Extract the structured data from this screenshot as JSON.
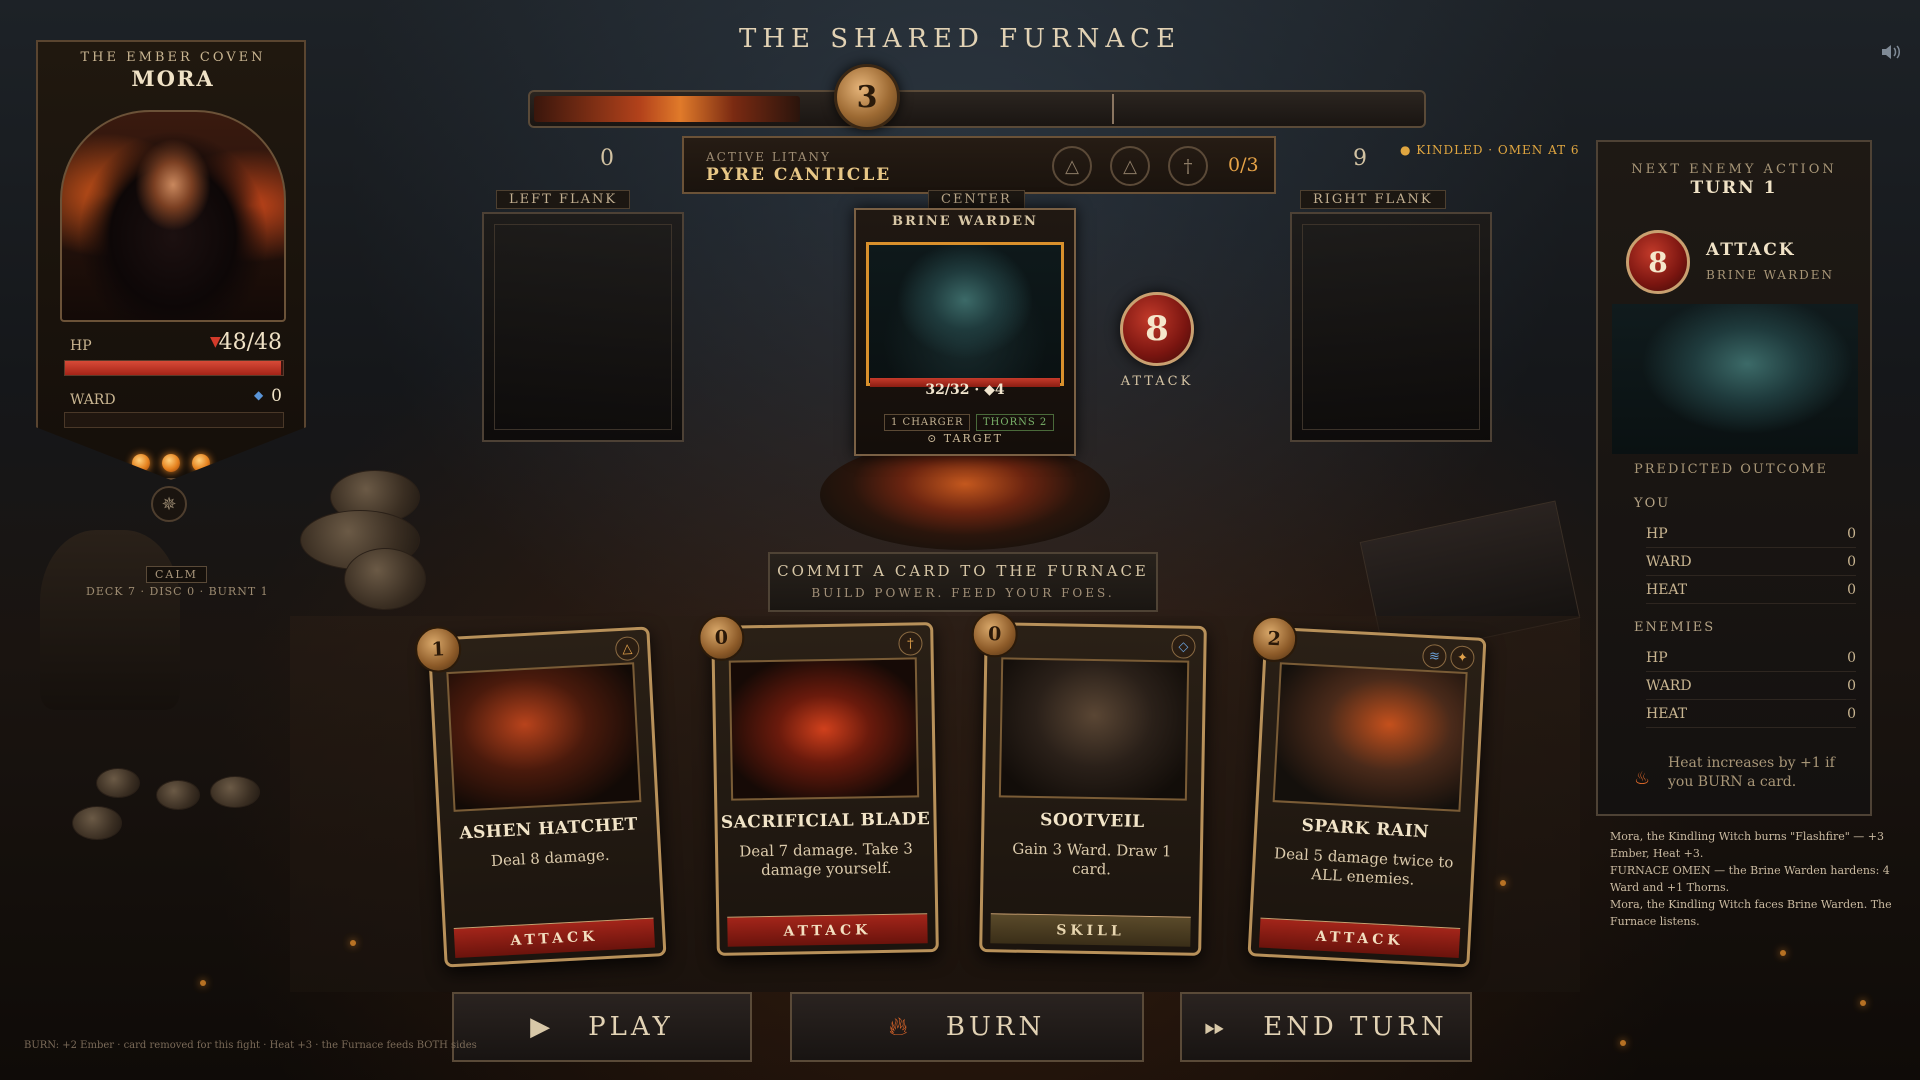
{
  "title": "THE SHARED FURNACE",
  "power": {
    "value": "3",
    "min_label": "0",
    "max_label": "9",
    "fill_fraction": 0.3
  },
  "omen_note": "● KINDLED · OMEN AT 6",
  "litany": {
    "label": "ACTIVE LITANY",
    "name": "PYRE CANTICLE",
    "glyphs": [
      "△",
      "△",
      "†"
    ],
    "progress": "0/3"
  },
  "player": {
    "coven": "THE EMBER COVEN",
    "name": "MORA",
    "hp_label": "HP",
    "hp_value": "48/48",
    "hp_fraction": 1.0,
    "ward_label": "WARD",
    "ward_value": "0",
    "ember_count": 3,
    "status": "CALM",
    "piles": "DECK 7 · DISC 0 · BURNT 1"
  },
  "flanks": {
    "left": "LEFT FLANK",
    "center": "CENTER",
    "right": "RIGHT FLANK"
  },
  "enemy": {
    "name": "BRINE WARDEN",
    "stats": "32/32 · ◆4",
    "hp_fraction": 1.0,
    "tags": [
      "1 CHARGER",
      "THORNS 2"
    ],
    "target_label": "⊙ TARGET",
    "intent_value": "8",
    "intent_label": "ATTACK"
  },
  "furnace_prompt": {
    "title": "COMMIT A CARD TO THE FURNACE",
    "subtitle": "BUILD POWER. FEED YOUR FOES."
  },
  "hand": [
    {
      "cost": "1",
      "name": "ASHEN HATCHET",
      "desc": "Deal 8 damage.",
      "type": "ATTACK",
      "elements": [
        "△"
      ]
    },
    {
      "cost": "0",
      "name": "SACRIFICIAL BLADE",
      "desc": "Deal 7 damage. Take 3 damage yourself.",
      "type": "ATTACK",
      "elements": [
        "†"
      ]
    },
    {
      "cost": "0",
      "name": "SOOTVEIL",
      "desc": "Gain 3 Ward. Draw 1 card.",
      "type": "SKILL",
      "elements": [
        "◇"
      ]
    },
    {
      "cost": "2",
      "name": "SPARK RAIN",
      "desc": "Deal 5 damage twice to ALL enemies.",
      "type": "ATTACK",
      "elements": [
        "≋",
        "✦"
      ]
    }
  ],
  "buttons": {
    "play": "PLAY",
    "burn": "BURN",
    "end_turn": "END TURN"
  },
  "footer_log": "BURN: +2 Ember · card removed for this fight · Heat +3 · the Furnace feeds BOTH sides",
  "next_action": {
    "title": "NEXT ENEMY ACTION",
    "turn": "TURN 1",
    "value": "8",
    "action": "ATTACK",
    "enemy": "BRINE WARDEN",
    "predicted_label": "PREDICTED OUTCOME",
    "you_label": "YOU",
    "you": [
      {
        "k": "HP",
        "v": "0"
      },
      {
        "k": "WARD",
        "v": "0"
      },
      {
        "k": "HEAT",
        "v": "0"
      }
    ],
    "enemies_label": "ENEMIES",
    "enemies": [
      {
        "k": "HP",
        "v": "0"
      },
      {
        "k": "WARD",
        "v": "0"
      },
      {
        "k": "HEAT",
        "v": "0"
      }
    ],
    "heat_note": "Heat increases by +1 if you BURN a card."
  },
  "combat_log": [
    "Mora, the Kindling Witch burns \"Flashfire\" — +3 Ember, Heat +3.",
    "FURNACE OMEN — the Brine Warden hardens: 4 Ward and +1 Thorns.",
    "Mora, the Kindling Witch faces Brine Warden. The Furnace listens."
  ],
  "colors": {
    "accent_gold": "#c9a070",
    "ember": "#e5821f",
    "attack_red": "#a3251a",
    "ward_blue": "#5a95d8"
  }
}
